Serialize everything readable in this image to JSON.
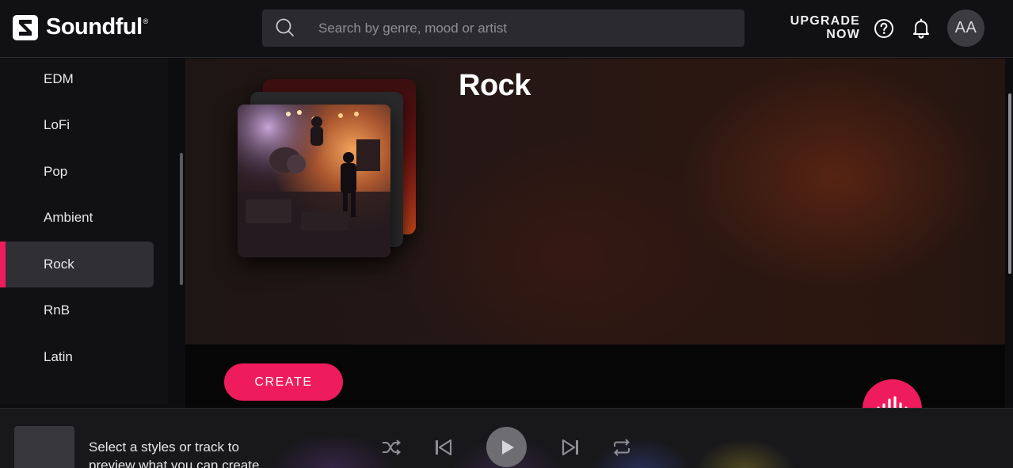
{
  "header": {
    "brand": "Soundful",
    "search_placeholder": "Search by genre, mood or artist",
    "upgrade_line1": "UPGRADE",
    "upgrade_line2": "NOW",
    "avatar_initials": "AA"
  },
  "sidebar": {
    "items": [
      {
        "label": "EDM"
      },
      {
        "label": "LoFi"
      },
      {
        "label": "Pop"
      },
      {
        "label": "Ambient"
      },
      {
        "label": "Rock",
        "active": true
      },
      {
        "label": "RnB"
      },
      {
        "label": "Latin"
      }
    ]
  },
  "hero": {
    "title": "Rock",
    "create_label": "CREATE"
  },
  "player": {
    "prompt_line1": "Select a styles or track to",
    "prompt_line2": "preview what you can create"
  },
  "colors": {
    "accent": "#ee1c5d",
    "background": "#0d0d0f",
    "sidebar_active": "#2f2f34"
  },
  "icons": [
    "logo-mark-icon",
    "search-icon",
    "help-icon",
    "bell-icon",
    "shuffle-icon",
    "skip-previous-icon",
    "play-icon",
    "skip-next-icon",
    "repeat-icon",
    "waveform-icon"
  ]
}
